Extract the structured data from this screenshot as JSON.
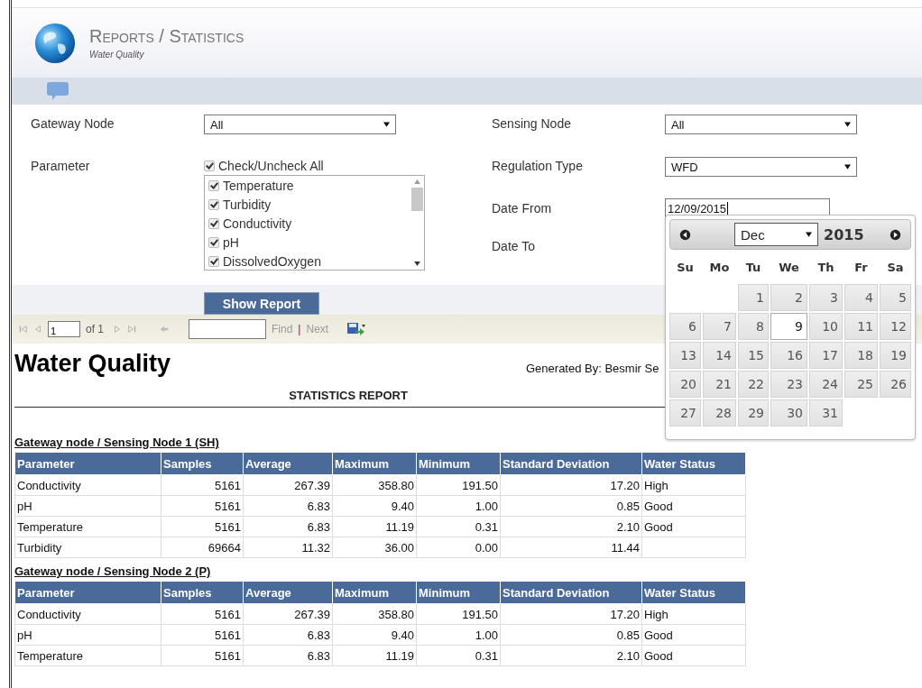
{
  "header": {
    "title": "Reports / Statistics",
    "subtitle": "Water Quality"
  },
  "form": {
    "gateway_node": {
      "label": "Gateway Node",
      "value": "All"
    },
    "sensing_node": {
      "label": "Sensing Node",
      "value": "All"
    },
    "parameter": {
      "label": "Parameter",
      "check_all": {
        "label": "Check/Uncheck All",
        "checked": true
      },
      "items": [
        {
          "label": "Temperature",
          "checked": true
        },
        {
          "label": "Turbidity",
          "checked": true
        },
        {
          "label": "Conductivity",
          "checked": true
        },
        {
          "label": "pH",
          "checked": true
        },
        {
          "label": "DissolvedOxygen",
          "checked": true
        }
      ]
    },
    "regulation_type": {
      "label": "Regulation Type",
      "value": "WFD"
    },
    "date_from": {
      "label": "Date From",
      "value": "12/09/2015"
    },
    "date_to": {
      "label": "Date To"
    },
    "show_report": "Show Report"
  },
  "toolbar": {
    "page": "1",
    "of": "of 1",
    "find": "Find",
    "separator": "|",
    "next": "Next"
  },
  "calendar": {
    "month": "Dec",
    "year": "2015",
    "weekdays": [
      "Su",
      "Mo",
      "Tu",
      "We",
      "Th",
      "Fr",
      "Sa"
    ],
    "weeks": [
      [
        {
          "day": "1",
          "selected": false
        },
        {
          "day": "2",
          "selected": false
        },
        {
          "day": "3",
          "selected": false
        },
        {
          "day": "4",
          "selected": false
        },
        {
          "day": "5",
          "selected": false
        }
      ],
      [
        {
          "day": "6",
          "selected": false
        },
        {
          "day": "7",
          "selected": false
        },
        {
          "day": "8",
          "selected": false
        },
        {
          "day": "9",
          "selected": true
        },
        {
          "day": "10",
          "selected": false
        },
        {
          "day": "11",
          "selected": false
        },
        {
          "day": "12",
          "selected": false
        }
      ],
      [
        {
          "day": "13",
          "selected": false
        },
        {
          "day": "14",
          "selected": false
        },
        {
          "day": "15",
          "selected": false
        },
        {
          "day": "16",
          "selected": false
        },
        {
          "day": "17",
          "selected": false
        },
        {
          "day": "18",
          "selected": false
        },
        {
          "day": "19",
          "selected": false
        }
      ],
      [
        {
          "day": "20",
          "selected": false
        },
        {
          "day": "21",
          "selected": false
        },
        {
          "day": "22",
          "selected": false
        },
        {
          "day": "23",
          "selected": false
        },
        {
          "day": "24",
          "selected": false
        },
        {
          "day": "25",
          "selected": false
        },
        {
          "day": "26",
          "selected": false
        }
      ],
      [
        {
          "day": "27",
          "selected": false
        },
        {
          "day": "28",
          "selected": false
        },
        {
          "day": "29",
          "selected": false
        },
        {
          "day": "30",
          "selected": false
        },
        {
          "day": "31",
          "selected": false
        }
      ]
    ]
  },
  "report": {
    "title": "Water Quality",
    "generated_by": "Generated By: Besmir Se",
    "heading": "STATISTICS REPORT",
    "sections": [
      {
        "title": "Gateway node / Sensing Node 1 (SH)",
        "columns": [
          "Parameter",
          "Samples",
          "Average",
          "Maximum",
          "Minimum",
          "Standard Deviation",
          "Water Status"
        ],
        "rows": [
          [
            "Conductivity",
            "5161",
            "267.39",
            "358.80",
            "191.50",
            "17.20",
            "High"
          ],
          [
            "pH",
            "5161",
            "6.83",
            "9.40",
            "1.00",
            "0.85",
            "Good"
          ],
          [
            "Temperature",
            "5161",
            "6.83",
            "11.19",
            "0.31",
            "2.10",
            "Good"
          ],
          [
            "Turbidity",
            "69664",
            "11.32",
            "36.00",
            "0.00",
            "11.44",
            ""
          ]
        ]
      },
      {
        "title": "Gateway node / Sensing Node 2 (P)",
        "columns": [
          "Parameter",
          "Samples",
          "Average",
          "Maximum",
          "Minimum",
          "Standard Deviation",
          "Water Status"
        ],
        "rows": [
          [
            "Conductivity",
            "5161",
            "267.39",
            "358.80",
            "191.50",
            "17.20",
            "High"
          ],
          [
            "pH",
            "5161",
            "6.83",
            "9.40",
            "1.00",
            "0.85",
            "Good"
          ],
          [
            "Temperature",
            "5161",
            "6.83",
            "11.19",
            "0.31",
            "2.10",
            "Good"
          ]
        ]
      }
    ]
  }
}
